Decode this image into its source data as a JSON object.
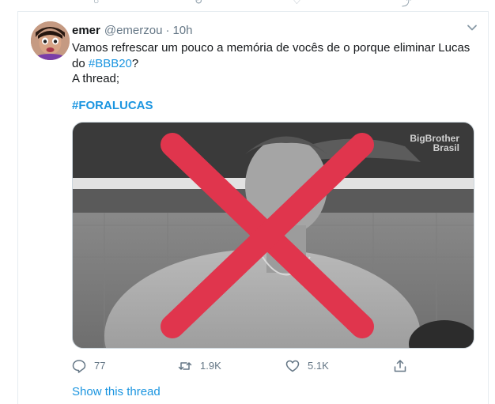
{
  "tweet": {
    "display_name": "emer",
    "handle": "@emerzou",
    "separator": "·",
    "time": "10h",
    "text_line1": "Vamos refrescar um pouco a memória de vocês de o porque eliminar Lucas",
    "text_line2_prefix": "do ",
    "text_line2_link": "#BBB20",
    "text_line2_suffix": "?",
    "text_line3": "A thread;",
    "hashtag": "#FORALUCAS",
    "media_watermark_line1": "BigBrother",
    "media_watermark_line2": "Brasil",
    "replies": "77",
    "retweets": "1.9K",
    "likes": "5.1K",
    "show_thread": "Show this thread"
  },
  "colors": {
    "link": "#1b95e0",
    "muted": "#657786",
    "cross": "#e0354d",
    "border": "#e6ecf0"
  }
}
